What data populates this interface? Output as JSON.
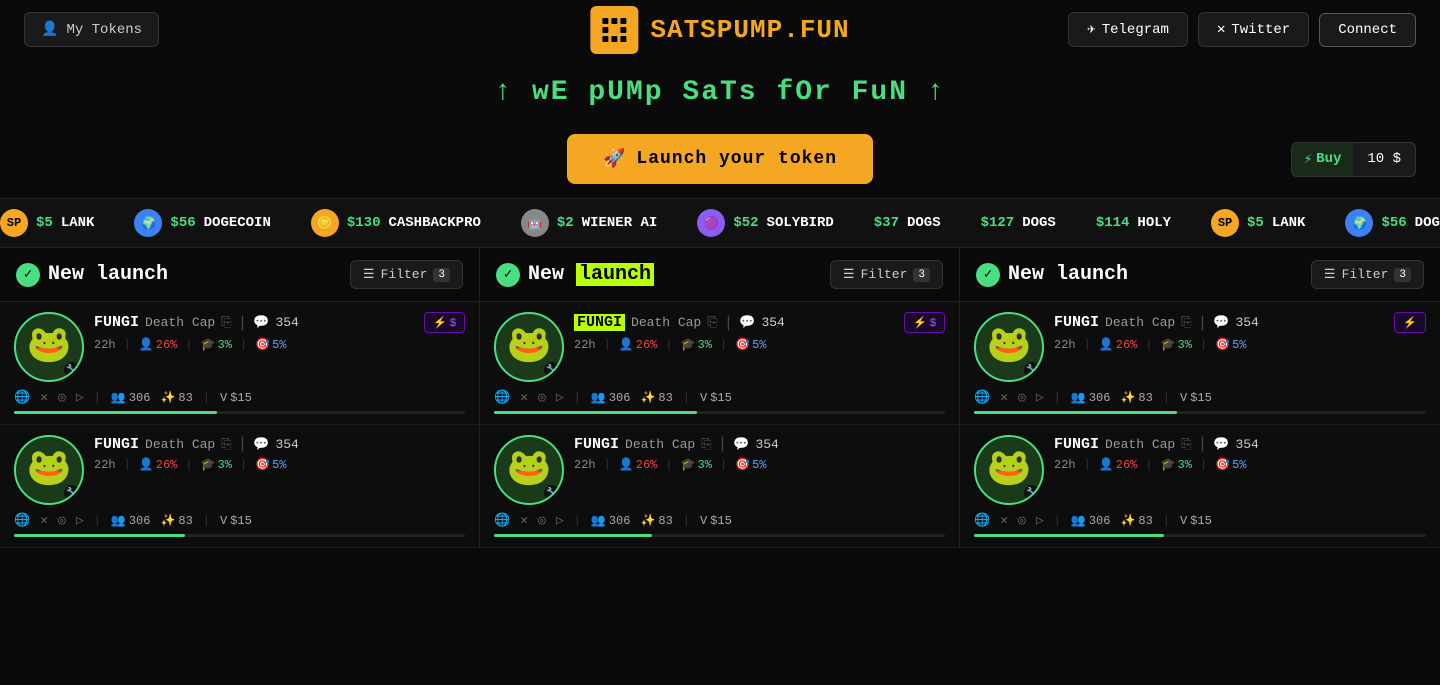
{
  "header": {
    "my_tokens_label": "My Tokens",
    "logo_text_main": "SATSPUMP.",
    "logo_text_accent": "FUN",
    "telegram_label": "Telegram",
    "twitter_label": "Twitter",
    "connect_label": "Connect"
  },
  "hero": {
    "tagline": "↑  wE pUMp SaTs fOr FuN  ↑"
  },
  "launch": {
    "button_label": "Launch your token",
    "buy_label": "⚡ Buy",
    "buy_amount": "10 $"
  },
  "ticker": {
    "items": [
      {
        "icon": "🟧",
        "icon_bg": "#f5a623",
        "price": "$5",
        "name": "LANK"
      },
      {
        "icon": "🌍",
        "icon_bg": "#3b82f6",
        "price": "$56",
        "name": "DOGECOIN"
      },
      {
        "icon": "🪙",
        "icon_bg": "#f5a623",
        "price": "$130",
        "name": "CASHBACKPRO"
      },
      {
        "icon": "⬜",
        "icon_bg": "#888",
        "price": "$2",
        "name": "WIENER AI"
      },
      {
        "icon": "🟣",
        "icon_bg": "#8b5cf6",
        "price": "$52",
        "name": "SOLYBIRD"
      },
      {
        "icon": "🟢",
        "icon_bg": "#4ade80",
        "price": "$37",
        "name": "DOGS"
      },
      {
        "icon": "🟢",
        "icon_bg": "#4ade80",
        "price": "$127",
        "name": "DOGS"
      },
      {
        "icon": "🟡",
        "icon_bg": "#eab308",
        "price": "$114",
        "name": "HOLY"
      }
    ]
  },
  "columns": [
    {
      "title_plain": "New launch",
      "title_highlighted": false,
      "filter_label": "Filter",
      "filter_count": "3"
    },
    {
      "title_plain": "New launch",
      "title_highlighted": true,
      "filter_label": "Filter",
      "filter_count": "3"
    },
    {
      "title_plain": "New launch",
      "title_highlighted": false,
      "filter_label": "Filter",
      "filter_count": "3"
    }
  ],
  "token_card_template": {
    "name": "FUNGI",
    "desc": "Death Cap",
    "comments": "354",
    "age": "22h",
    "stat1_pct": "26%",
    "stat2_pct": "3%",
    "stat3_pct": "5%",
    "holders": "306",
    "sparkles": "83",
    "volume": "$15",
    "boost_label": "$",
    "progress_pct": 45
  },
  "colors": {
    "accent_green": "#4ade80",
    "accent_orange": "#f5a623",
    "accent_purple": "#a855f7",
    "bg_dark": "#0a0a0a",
    "card_bg": "#0d0d0d"
  }
}
